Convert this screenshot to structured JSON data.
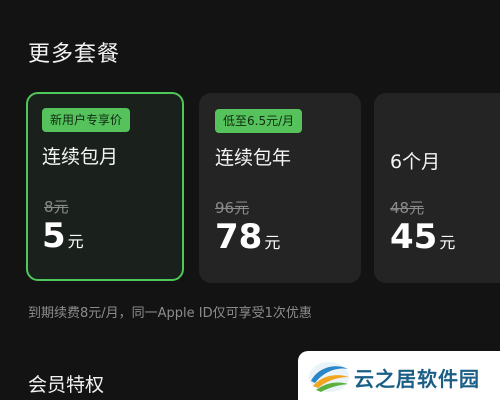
{
  "section_title": "更多套餐",
  "plans": [
    {
      "badge": "新用户专享价",
      "name": "连续包月",
      "old_price": "8元",
      "price": "5",
      "unit": "元",
      "selected": true
    },
    {
      "badge": "低至6.5元/月",
      "name": "连续包年",
      "old_price": "96元",
      "price": "78",
      "unit": "元",
      "selected": false
    },
    {
      "badge": "",
      "name": "6个月",
      "old_price": "48元",
      "price": "45",
      "unit": "元",
      "selected": false
    }
  ],
  "renew_note": "到期续费8元/月，同一Apple ID仅可享受1次优惠",
  "section2_title": "会员特权",
  "watermark": {
    "text": "云之居软件园",
    "icon": "yunzhiju-logo"
  },
  "colors": {
    "accent_green": "#4fc85a",
    "badge_green": "#55c25c",
    "background": "#131313",
    "card": "#242424"
  }
}
